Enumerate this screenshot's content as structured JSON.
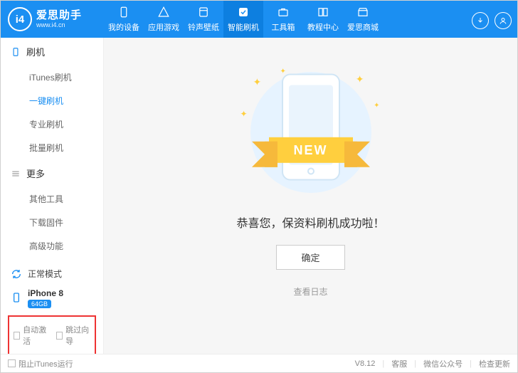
{
  "app": {
    "logo_badge": "i4",
    "name": "爱思助手",
    "site": "www.i4.cn"
  },
  "nav": {
    "items": [
      {
        "label": "我的设备",
        "icon": "device"
      },
      {
        "label": "应用游戏",
        "icon": "apps"
      },
      {
        "label": "铃声壁纸",
        "icon": "music"
      },
      {
        "label": "智能刷机",
        "icon": "flash"
      },
      {
        "label": "工具箱",
        "icon": "tools"
      },
      {
        "label": "教程中心",
        "icon": "help"
      },
      {
        "label": "爱思商城",
        "icon": "store"
      }
    ],
    "active_index": 3
  },
  "sidebar": {
    "sec1": {
      "title": "刷机",
      "items": [
        "iTunes刷机",
        "一键刷机",
        "专业刷机",
        "批量刷机"
      ],
      "active": 1
    },
    "sec2": {
      "title": "更多",
      "items": [
        "其他工具",
        "下载固件",
        "高级功能"
      ]
    },
    "mode": "正常模式",
    "device": {
      "name": "iPhone 8",
      "storage": "64GB"
    },
    "cb1": "自动激活",
    "cb2": "跳过向导"
  },
  "main": {
    "ribbon": "NEW",
    "message": "恭喜您，保资料刷机成功啦！",
    "ok": "确定",
    "view_log": "查看日志"
  },
  "footer": {
    "block_itunes": "阻止iTunes运行",
    "version": "V8.12",
    "support": "客服",
    "wechat": "微信公众号",
    "update": "检查更新"
  }
}
